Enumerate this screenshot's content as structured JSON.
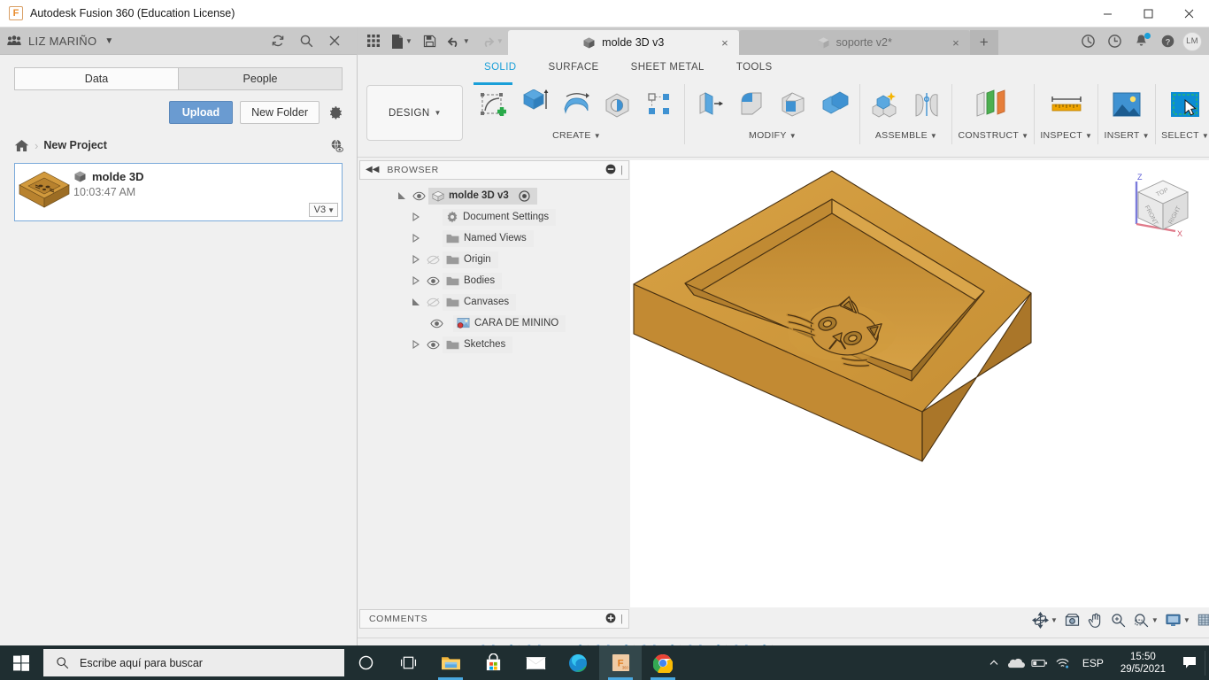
{
  "titlebar": {
    "app_title": "Autodesk Fusion 360 (Education License)",
    "logo_letter": "F",
    "minimize": "minimize-icon",
    "maximize": "maximize-icon",
    "close": "close-icon"
  },
  "data_panel": {
    "user_name": "LIZ MARIÑO",
    "header_icons": [
      "refresh-icon",
      "search-icon",
      "close-icon"
    ],
    "tabs": [
      {
        "label": "Data",
        "active": true
      },
      {
        "label": "People",
        "active": false
      }
    ],
    "upload_label": "Upload",
    "new_folder_label": "New Folder",
    "settings_icon": "gear-icon",
    "breadcrumb": {
      "home_icon": "home-icon",
      "separator": "›",
      "project": "New Project",
      "globe_icon": "globe-eye-icon"
    },
    "file": {
      "name": "molde 3D",
      "time": "10:03:47 AM",
      "version": "V3",
      "type_icon": "cube-icon"
    }
  },
  "fusion": {
    "qat": [
      "grid-apps-icon",
      "new-file-icon",
      "save-icon",
      "undo-icon",
      "redo-icon"
    ],
    "doc_tabs": [
      {
        "label": "molde 3D v3",
        "active": true,
        "close": "×"
      },
      {
        "label": "soporte v2*",
        "active": false,
        "close": "×"
      }
    ],
    "new_tab_label": "+",
    "tab_right_icons": [
      "job-status-icon",
      "recent-icon",
      "notifications-icon",
      "help-icon"
    ],
    "avatar_initials": "LM",
    "ribbon_tabs": [
      {
        "label": "SOLID",
        "active": true
      },
      {
        "label": "SURFACE",
        "active": false
      },
      {
        "label": "SHEET METAL",
        "active": false
      },
      {
        "label": "TOOLS",
        "active": false
      }
    ],
    "design_label": "DESIGN",
    "ribbon_groups": [
      {
        "label": "CREATE",
        "icons": [
          "create-sketch-icon",
          "extrude-icon",
          "revolve-icon",
          "sweep-icon",
          "pattern-icon"
        ]
      },
      {
        "label": "MODIFY",
        "icons": [
          "press-pull-icon",
          "fillet-icon",
          "shell-icon",
          "combine-icon"
        ]
      },
      {
        "label": "ASSEMBLE",
        "icons": [
          "new-component-icon",
          "joint-icon"
        ]
      },
      {
        "label": "CONSTRUCT",
        "icons": [
          "offset-plane-icon"
        ]
      },
      {
        "label": "INSPECT",
        "icons": [
          "measure-icon"
        ]
      },
      {
        "label": "INSERT",
        "icons": [
          "insert-canvas-icon"
        ]
      },
      {
        "label": "SELECT",
        "icons": [
          "select-window-icon"
        ]
      }
    ],
    "browser": {
      "title": "BROWSER",
      "collapse_icon": "collapse-left-icon",
      "minus_icon": "minus-circle-icon",
      "tree": [
        {
          "label": "molde 3D v3",
          "level": 0,
          "arrow": "expanded",
          "eye": "visible",
          "icon": "component-icon",
          "root": true,
          "has_target": true
        },
        {
          "label": "Document Settings",
          "level": 1,
          "arrow": "collapsed",
          "eye": "none",
          "icon": "gear-icon"
        },
        {
          "label": "Named Views",
          "level": 1,
          "arrow": "collapsed",
          "eye": "none",
          "icon": "folder-icon"
        },
        {
          "label": "Origin",
          "level": 1,
          "arrow": "collapsed",
          "eye": "hidden",
          "icon": "folder-icon"
        },
        {
          "label": "Bodies",
          "level": 1,
          "arrow": "collapsed",
          "eye": "visible",
          "icon": "folder-icon"
        },
        {
          "label": "Canvases",
          "level": 1,
          "arrow": "expanded",
          "eye": "hidden",
          "icon": "folder-icon"
        },
        {
          "label": "CARA DE MININO",
          "level": 2,
          "arrow": "none",
          "eye": "visible",
          "icon": "canvas-image-icon"
        },
        {
          "label": "Sketches",
          "level": 1,
          "arrow": "collapsed",
          "eye": "visible",
          "icon": "folder-icon"
        }
      ]
    },
    "comments": {
      "title": "COMMENTS",
      "add_icon": "plus-circle-icon"
    },
    "navbar": [
      "orbit-icon",
      "look-at-icon",
      "pan-icon",
      "zoom-icon",
      "zoom-window-icon",
      "display-settings-icon",
      "grid-snaps-icon",
      "viewports-icon"
    ],
    "viewcube": {
      "faces": [
        "TOP",
        "FRONT",
        "RIGHT"
      ],
      "axis_z": "Z",
      "axis_x": "X"
    },
    "model": {
      "name": "molde 3D mold tray with cat face emboss",
      "color_top": "#d29a3d",
      "color_front": "#c08a33",
      "color_inner": "#cb9238",
      "edge_color": "#4a3212"
    },
    "timeline": {
      "playback": [
        "go-to-start-icon",
        "step-back-icon",
        "play-icon",
        "step-forward-icon",
        "go-to-end-icon"
      ],
      "features": [
        "sketch-icon",
        "extrude-icon",
        "sketch-icon",
        "canvas-icon",
        "extrude-icon",
        "sketch-icon",
        "extrude-icon",
        "sketch-icon",
        "extrude-icon",
        "sketch-icon",
        "extrude-icon",
        "sketch-icon",
        "extrude-icon",
        "fillet-icon",
        "fillet-icon",
        "fillet-icon",
        "fillet-icon",
        "fillet-icon",
        "fillet-icon",
        "fillet-icon",
        "fillet-icon"
      ],
      "settings_icon": "gear-icon"
    }
  },
  "taskbar": {
    "start_icon": "windows-start-icon",
    "search_placeholder": "Escribe aquí para buscar",
    "search_icon": "search-icon",
    "apps": [
      {
        "name": "cortana-icon",
        "running": false,
        "active": false
      },
      {
        "name": "task-view-icon",
        "running": false,
        "active": false
      },
      {
        "name": "file-explorer-icon",
        "running": true,
        "active": false
      },
      {
        "name": "microsoft-store-icon",
        "running": false,
        "active": false
      },
      {
        "name": "mail-icon",
        "running": false,
        "active": false
      },
      {
        "name": "microsoft-edge-icon",
        "running": false,
        "active": false
      },
      {
        "name": "fusion-360-icon",
        "running": true,
        "active": true
      },
      {
        "name": "google-chrome-icon",
        "running": true,
        "active": false
      }
    ],
    "tray_icons": [
      "show-hidden-icons-icon",
      "onedrive-icon",
      "battery-icon",
      "wifi-icon"
    ],
    "language": "ESP",
    "time": "15:50",
    "date": "29/5/2021",
    "action_center_icon": "action-center-icon"
  }
}
